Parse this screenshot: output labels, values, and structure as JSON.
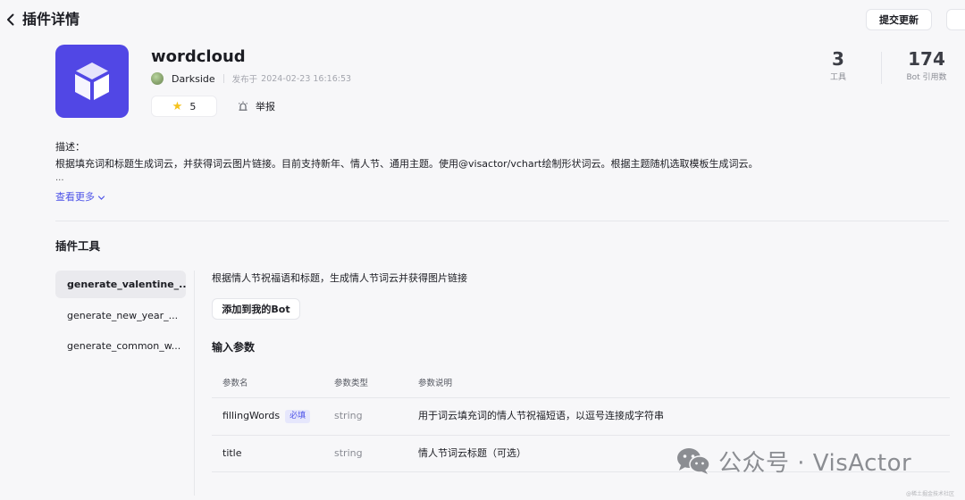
{
  "header": {
    "title": "插件详情",
    "submit_label": "提交更新"
  },
  "plugin": {
    "name": "wordcloud",
    "author": "Darkside",
    "published_label": "发布于",
    "published_time": "2024-02-23 16:16:53",
    "stars": "5",
    "report_label": "举报",
    "brand_color": "#5147e5"
  },
  "stats": {
    "tools_count": "3",
    "tools_label": "工具",
    "bots_count": "174",
    "bots_label": "Bot 引用数"
  },
  "description": {
    "label": "描述：",
    "text": "根据填充词和标题生成词云，并获得词云图片链接。目前支持新年、情人节、通用主题。使用@visactor/vchart绘制形状词云。根据主题随机选取模板生成词云。",
    "ellipsis": "...",
    "see_more": "查看更多"
  },
  "tools_section": {
    "title": "插件工具",
    "items": [
      {
        "label": "generate_valentine_...",
        "active": true
      },
      {
        "label": "generate_new_year_...",
        "active": false
      },
      {
        "label": "generate_common_w...",
        "active": false
      }
    ]
  },
  "selected_tool": {
    "description": "根据情人节祝福语和标题，生成情人节词云并获得图片链接",
    "add_button": "添加到我的Bot",
    "params_title": "输入参数",
    "columns": [
      "参数名",
      "参数类型",
      "参数说明"
    ],
    "rows": [
      {
        "name": "fillingWords",
        "required_badge": "必填",
        "type": "string",
        "desc": "用于词云填充词的情人节祝福短语，以逗号连接成字符串"
      },
      {
        "name": "title",
        "type": "string",
        "desc": "情人节词云标题（可选）"
      }
    ]
  },
  "watermark": {
    "text": "公众号 · VisActor",
    "small_text": "@稀土掘金技术社区"
  },
  "accent_color": "#4d53e8"
}
